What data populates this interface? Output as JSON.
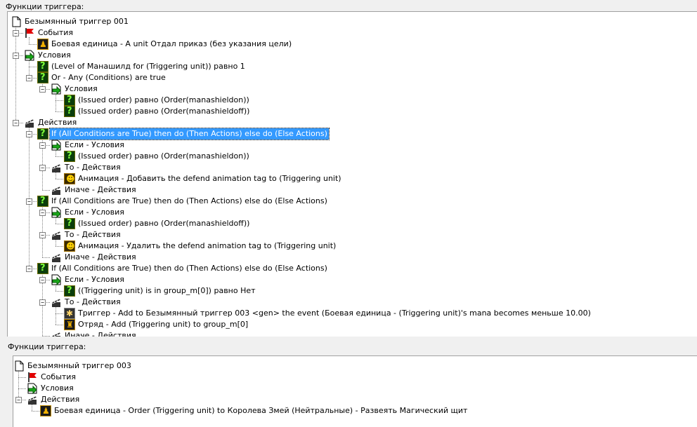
{
  "panel1": {
    "title": "Функции триггера:",
    "rows": [
      {
        "depth": 0,
        "exp": "",
        "icon": "page",
        "text": "Безымянный триггер 001"
      },
      {
        "depth": 1,
        "exp": "−",
        "icon": "flag",
        "text": "События"
      },
      {
        "depth": 2,
        "exp": "",
        "icon": "unit",
        "text": "Боевая единица - A unit Отдал приказ (без указания цели)"
      },
      {
        "depth": 1,
        "exp": "−",
        "icon": "cond",
        "text": "Условия"
      },
      {
        "depth": 2,
        "exp": "",
        "icon": "q",
        "text": "(Level of Манашилд  for (Triggering unit)) равно 1"
      },
      {
        "depth": 2,
        "exp": "−",
        "icon": "q",
        "text": "Or - Any (Conditions) are true"
      },
      {
        "depth": 3,
        "exp": "−",
        "icon": "cond",
        "text": "Условия"
      },
      {
        "depth": 4,
        "exp": "",
        "icon": "q",
        "text": "(Issued order) равно (Order(manashieldon))"
      },
      {
        "depth": 4,
        "exp": "",
        "icon": "q",
        "text": "(Issued order) равно (Order(manashieldoff))"
      },
      {
        "depth": 1,
        "exp": "−",
        "icon": "act",
        "text": "Действия"
      },
      {
        "depth": 2,
        "exp": "−",
        "icon": "q",
        "text": "If (All Conditions are True) then do (Then Actions) else do (Else Actions)",
        "selected": true
      },
      {
        "depth": 3,
        "exp": "−",
        "icon": "cond",
        "text": "Если - Условия"
      },
      {
        "depth": 4,
        "exp": "",
        "icon": "q",
        "text": "(Issued order) равно (Order(manashieldon))"
      },
      {
        "depth": 3,
        "exp": "−",
        "icon": "act",
        "text": "То - Действия"
      },
      {
        "depth": 4,
        "exp": "",
        "icon": "anim",
        "text": "Анимация - Добавить the defend animation tag to (Triggering unit)"
      },
      {
        "depth": 3,
        "exp": "",
        "icon": "act",
        "text": "Иначе - Действия"
      },
      {
        "depth": 2,
        "exp": "−",
        "icon": "q",
        "text": "If (All Conditions are True) then do (Then Actions) else do (Else Actions)"
      },
      {
        "depth": 3,
        "exp": "−",
        "icon": "cond",
        "text": "Если - Условия"
      },
      {
        "depth": 4,
        "exp": "",
        "icon": "q",
        "text": "(Issued order) равно (Order(manashieldoff))"
      },
      {
        "depth": 3,
        "exp": "−",
        "icon": "act",
        "text": "То - Действия"
      },
      {
        "depth": 4,
        "exp": "",
        "icon": "anim",
        "text": "Анимация - Удалить the defend animation tag to (Triggering unit)"
      },
      {
        "depth": 3,
        "exp": "",
        "icon": "act",
        "text": "Иначе - Действия"
      },
      {
        "depth": 2,
        "exp": "−",
        "icon": "q",
        "text": "If (All Conditions are True) then do (Then Actions) else do (Else Actions)"
      },
      {
        "depth": 3,
        "exp": "−",
        "icon": "cond",
        "text": "Если - Условия"
      },
      {
        "depth": 4,
        "exp": "",
        "icon": "q",
        "text": "((Triggering unit) is in group_m[0]) равно Нет"
      },
      {
        "depth": 3,
        "exp": "−",
        "icon": "act",
        "text": "То - Действия"
      },
      {
        "depth": 4,
        "exp": "",
        "icon": "trig",
        "text": "Триггер - Add to Безымянный триггер 003 <gen> the event (Боевая единица - (Triggering unit)'s mana becomes меньше 10.00)"
      },
      {
        "depth": 4,
        "exp": "",
        "icon": "grp",
        "text": "Отряд - Add (Triggering unit) to group_m[0]"
      },
      {
        "depth": 3,
        "exp": "",
        "icon": "act",
        "text": "Иначе - Действия"
      }
    ]
  },
  "panel2": {
    "title": "Функции триггера:",
    "rows": [
      {
        "depth": 0,
        "exp": "",
        "icon": "page",
        "text": "Безымянный триггер 003"
      },
      {
        "depth": 1,
        "exp": "",
        "icon": "flag",
        "text": "События"
      },
      {
        "depth": 1,
        "exp": "",
        "icon": "cond",
        "text": "Условия"
      },
      {
        "depth": 1,
        "exp": "−",
        "icon": "act",
        "text": "Действия"
      },
      {
        "depth": 2,
        "exp": "",
        "icon": "unit",
        "text": "Боевая единица - Order (Triggering unit) to Королева Змей (Нейтральные) - Развеять Магический щит"
      }
    ]
  }
}
